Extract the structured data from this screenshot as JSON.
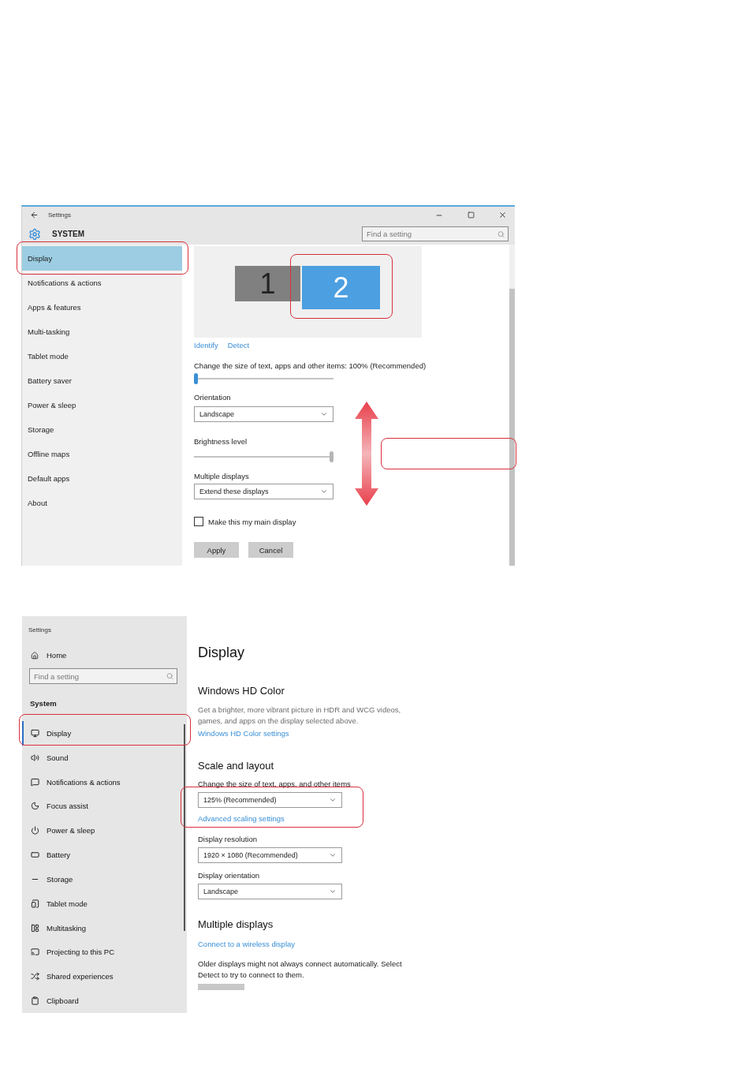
{
  "top_window": {
    "title": "Settings",
    "header": "SYSTEM",
    "search": {
      "placeholder": "Find a setting"
    },
    "nav": [
      {
        "label": "Display",
        "selected": true
      },
      {
        "label": "Notifications & actions",
        "selected": false
      },
      {
        "label": "Apps & features",
        "selected": false
      },
      {
        "label": "Multi-tasking",
        "selected": false
      },
      {
        "label": "Tablet mode",
        "selected": false
      },
      {
        "label": "Battery saver",
        "selected": false
      },
      {
        "label": "Power & sleep",
        "selected": false
      },
      {
        "label": "Storage",
        "selected": false
      },
      {
        "label": "Offline maps",
        "selected": false
      },
      {
        "label": "Default apps",
        "selected": false
      },
      {
        "label": "About",
        "selected": false
      }
    ],
    "monitors": [
      {
        "label": "1",
        "selected": false
      },
      {
        "label": "2",
        "selected": true
      }
    ],
    "links": [
      "Identify",
      "Detect"
    ],
    "scale": {
      "label": "Change the size of text, apps and other items: 100% (Recommended)",
      "level": 0
    },
    "orientation": {
      "label": "Orientation",
      "value": "Landscape"
    },
    "brightness": {
      "label": "Brightness level",
      "level": 1
    },
    "multiple_displays": {
      "label": "Multiple displays",
      "value": "Extend these displays"
    },
    "main_display": {
      "label": "Make this my main display",
      "checked": false
    },
    "buttons": [
      "Apply",
      "Cancel"
    ]
  },
  "bottom_window": {
    "title": "Settings",
    "home": "Home",
    "search": {
      "placeholder": "Find a setting"
    },
    "section": "System",
    "nav": [
      {
        "label": "Display",
        "selected": true
      },
      {
        "label": "Sound",
        "selected": false
      },
      {
        "label": "Notifications & actions",
        "selected": false
      },
      {
        "label": "Focus assist",
        "selected": false
      },
      {
        "label": "Power & sleep",
        "selected": false
      },
      {
        "label": "Battery",
        "selected": false
      },
      {
        "label": "Storage",
        "selected": false
      },
      {
        "label": "Tablet mode",
        "selected": false
      },
      {
        "label": "Multitasking",
        "selected": false
      },
      {
        "label": "Projecting to this PC",
        "selected": false
      },
      {
        "label": "Shared experiences",
        "selected": false
      },
      {
        "label": "Clipboard",
        "selected": false
      }
    ],
    "heading": "Display",
    "hd_color": {
      "heading": "Windows HD Color",
      "description": "Get a brighter, more vibrant picture in HDR and WCG videos, games, and apps on the display selected above.",
      "link": "Windows HD Color settings"
    },
    "scale_layout": {
      "heading": "Scale and layout",
      "scale_label": "Change the size of text, apps, and other items",
      "scale_value": "125% (Recommended)",
      "link": "Advanced scaling settings",
      "resolution_label": "Display resolution",
      "resolution_value": "1920 × 1080 (Recommended)",
      "orientation_label": "Display orientation",
      "orientation_value": "Landscape"
    },
    "multiple_displays": {
      "heading": "Multiple displays",
      "link": "Connect to a wireless display",
      "description": "Older displays might not always connect automatically. Select Detect to try to connect to them."
    }
  }
}
